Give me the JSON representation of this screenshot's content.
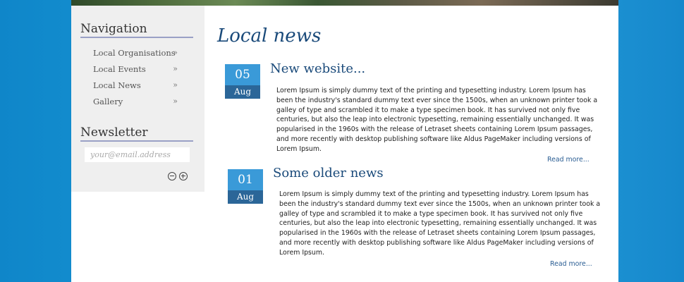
{
  "sidebar": {
    "navigation_heading": "Navigation",
    "nav_items": [
      {
        "label": "Local Organisations",
        "arrow": "»"
      },
      {
        "label": "Local Events",
        "arrow": "»"
      },
      {
        "label": "Local News",
        "arrow": "»"
      },
      {
        "label": "Gallery",
        "arrow": "»"
      }
    ],
    "newsletter_heading": "Newsletter",
    "email_placeholder": "your@email.address",
    "unsubscribe_icon": "minus-circle-icon",
    "subscribe_icon": "plus-circle-icon"
  },
  "main": {
    "title": "Local news",
    "posts": [
      {
        "day": "05",
        "month": "Aug",
        "title": "New website...",
        "body": "Lorem Ipsum is simply dummy text of the printing and typesetting industry. Lorem Ipsum has been the industry's standard dummy text ever since the 1500s, when an unknown printer took a galley of type and scrambled it to make a type specimen book. It has survived not only five centuries, but also the leap into electronic typesetting, remaining essentially unchanged. It was popularised in the 1960s with the release of Letraset sheets containing Lorem Ipsum passages, and more recently with desktop publishing software like Aldus PageMaker including versions of Lorem Ipsum.",
        "read_more": "Read more..."
      },
      {
        "day": "01",
        "month": "Aug",
        "title": "Some older news",
        "body": "Lorem Ipsum is simply dummy text of the printing and typesetting industry. Lorem Ipsum has been the industry's standard dummy text ever since the 1500s, when an unknown printer took a galley of type and scrambled it to make a type specimen book. It has survived not only five centuries, but also the leap into electronic typesetting, remaining essentially unchanged. It was popularised in the 1960s with the release of Letraset sheets containing Lorem Ipsum passages, and more recently with desktop publishing software like Aldus PageMaker including versions of Lorem Ipsum.",
        "read_more": "Read more..."
      }
    ]
  },
  "colors": {
    "background_blue": "#1a9bd9",
    "date_day_bg": "#3a9ad8",
    "date_month_bg": "#2b6698",
    "title_blue": "#1a4a7a",
    "sidebar_bg": "#efefef"
  }
}
